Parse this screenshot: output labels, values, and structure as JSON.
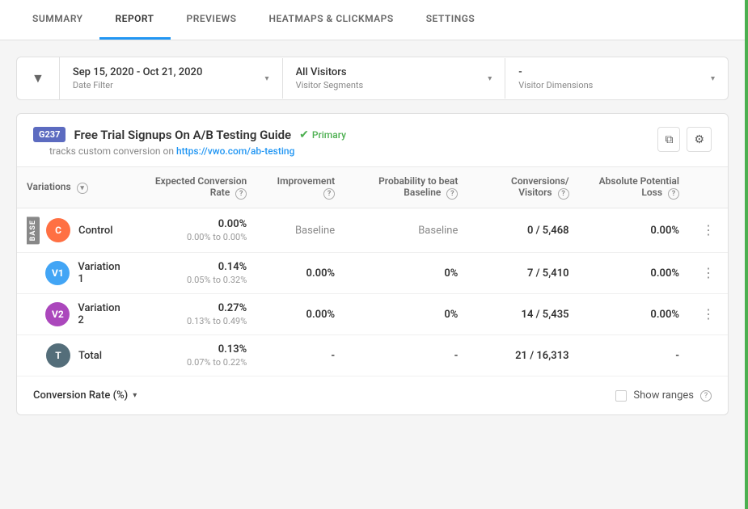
{
  "nav": {
    "tabs": [
      {
        "id": "summary",
        "label": "SUMMARY",
        "active": false
      },
      {
        "id": "report",
        "label": "REPORT",
        "active": true
      },
      {
        "id": "previews",
        "label": "PREVIEWS",
        "active": false
      },
      {
        "id": "heatmaps",
        "label": "HEATMAPS & CLICKMAPS",
        "active": false
      },
      {
        "id": "settings",
        "label": "SETTINGS",
        "active": false
      }
    ]
  },
  "filters": {
    "date": {
      "value": "Sep 15, 2020 - Oct 21, 2020",
      "label": "Date Filter"
    },
    "visitors": {
      "value": "All Visitors",
      "label": "Visitor Segments"
    },
    "dimensions": {
      "value": "-",
      "label": "Visitor Dimensions"
    }
  },
  "report": {
    "id": "G237",
    "title": "Free Trial Signups On A/B Testing Guide",
    "primary_label": "Primary",
    "subtitle": "tracks custom conversion on",
    "url": "https://vwo.com/ab-testing",
    "columns": {
      "variations": "Variations",
      "expected_rate": "Expected Conversion Rate",
      "improvement": "Improvement",
      "probability": "Probability to beat Baseline",
      "conversions": "Conversions/ Visitors",
      "potential_loss": "Absolute Potential Loss"
    },
    "rows": [
      {
        "id": "control",
        "is_base": true,
        "avatar_color": "#ff7043",
        "avatar_label": "C",
        "name": "Control",
        "rate_main": "0.00%",
        "rate_range": "0.00% to 0.00%",
        "improvement": "Baseline",
        "probability": "Baseline",
        "conversions": "0 / 5,468",
        "potential_loss": "0.00%"
      },
      {
        "id": "v1",
        "is_base": false,
        "avatar_color": "#42a5f5",
        "avatar_label": "V1",
        "name": "Variation 1",
        "rate_main": "0.14%",
        "rate_range": "0.05% to 0.32%",
        "improvement": "0.00%",
        "probability": "0%",
        "conversions": "7 / 5,410",
        "potential_loss": "0.00%"
      },
      {
        "id": "v2",
        "is_base": false,
        "avatar_color": "#ab47bc",
        "avatar_label": "V2",
        "name": "Variation 2",
        "rate_main": "0.27%",
        "rate_range": "0.13% to 0.49%",
        "improvement": "0.00%",
        "probability": "0%",
        "conversions": "14 / 5,435",
        "potential_loss": "0.00%"
      },
      {
        "id": "total",
        "is_base": false,
        "avatar_color": "#546e7a",
        "avatar_label": "T",
        "name": "Total",
        "rate_main": "0.13%",
        "rate_range": "0.07% to 0.22%",
        "improvement": "-",
        "probability": "-",
        "conversions": "21 / 16,313",
        "potential_loss": "-"
      }
    ]
  },
  "bottom": {
    "conversion_rate_label": "Conversion Rate (%)",
    "show_ranges_label": "Show ranges"
  },
  "icons": {
    "filter": "⚙",
    "help": "?",
    "more": "⋮",
    "check": "✓",
    "copy": "⧉",
    "settings": "⚙",
    "chevron_down": "▾",
    "sort": "▾"
  }
}
